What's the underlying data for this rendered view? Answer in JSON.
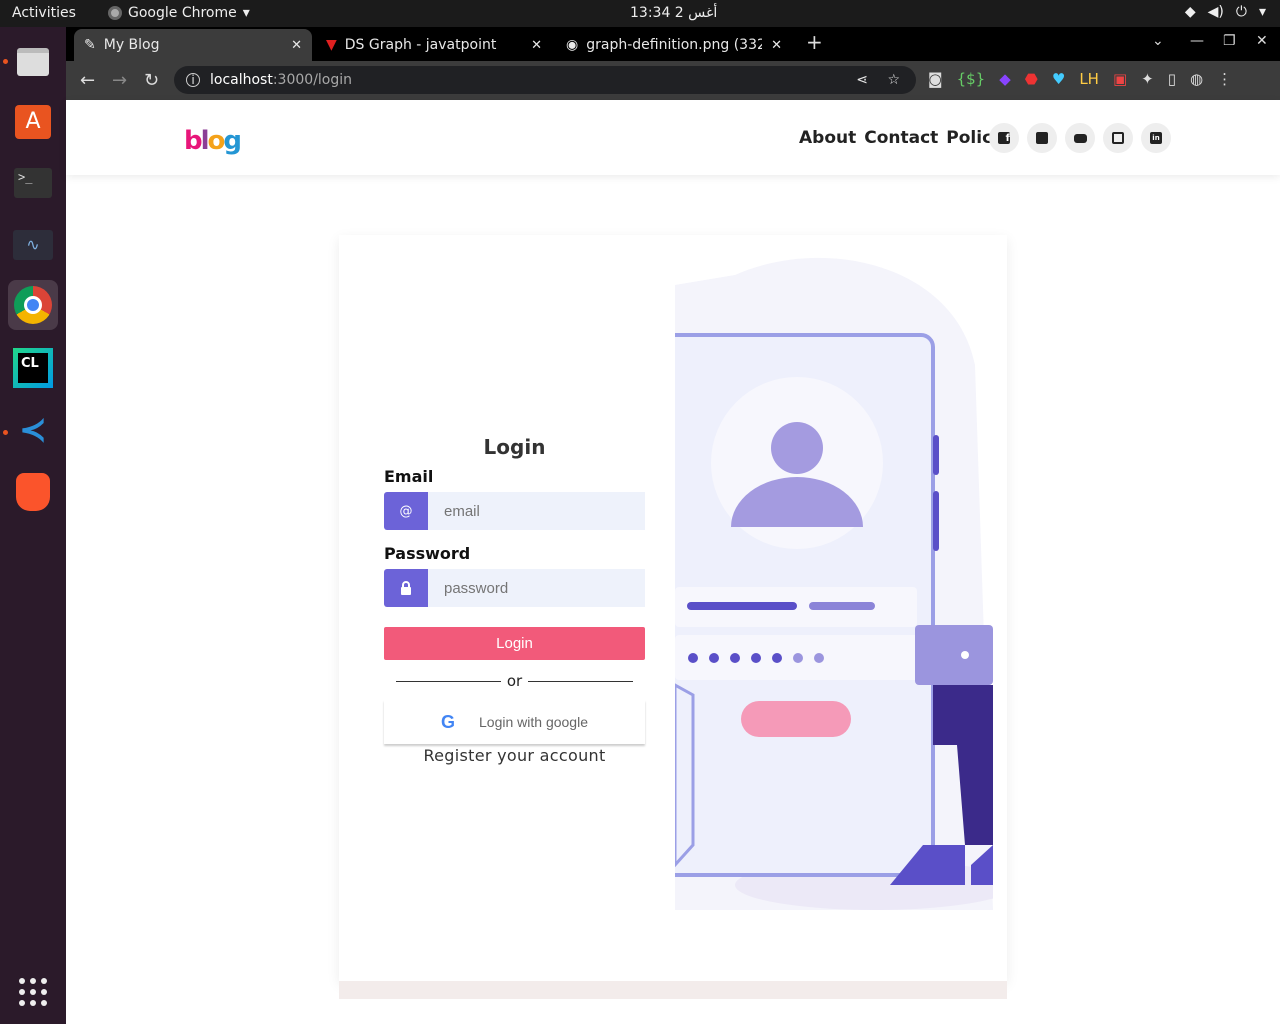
{
  "os": {
    "activities": "Activities",
    "app_menu": "Google Chrome",
    "clock": "13:34 أغس 2"
  },
  "browser": {
    "tabs": [
      {
        "title": "My Blog",
        "active": true
      },
      {
        "title": "DS Graph - javatpoint",
        "active": false
      },
      {
        "title": "graph-definition.png (332",
        "active": false
      }
    ],
    "address": {
      "host": "localhost",
      "path": ":3000/login"
    }
  },
  "site": {
    "logo": "blog",
    "nav": [
      "About",
      "Contact",
      "Policy"
    ],
    "social_icons": [
      "facebook-icon",
      "twitter-icon",
      "youtube-icon",
      "github-icon",
      "linkedin-icon"
    ]
  },
  "login": {
    "title": "Login",
    "email_label": "Email",
    "email_addon": "@",
    "email_placeholder": "email",
    "password_label": "Password",
    "password_placeholder": "password",
    "submit": "Login",
    "or": "or",
    "google": "Login with google",
    "register": "Register your account"
  },
  "colors": {
    "accent": "#6c63d8",
    "button": "#f25a7a",
    "input_bg": "#eef2fb"
  }
}
